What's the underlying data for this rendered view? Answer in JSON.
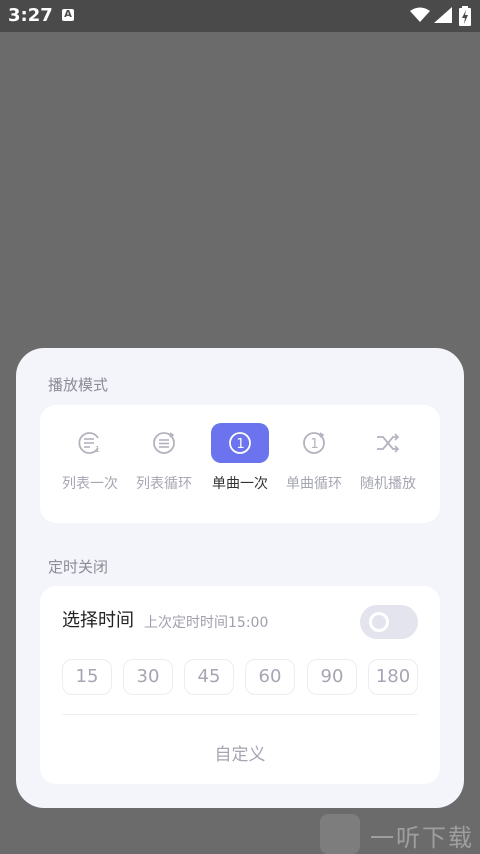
{
  "status_bar": {
    "time": "3:27",
    "notification_icon": "A"
  },
  "playback_mode": {
    "title": "播放模式",
    "modes": [
      {
        "label": "列表一次",
        "icon": "list-once-icon",
        "active": false
      },
      {
        "label": "列表循环",
        "icon": "list-loop-icon",
        "active": false
      },
      {
        "label": "单曲一次",
        "icon": "single-once-icon",
        "active": true
      },
      {
        "label": "单曲循环",
        "icon": "single-loop-icon",
        "active": false
      },
      {
        "label": "随机播放",
        "icon": "shuffle-icon",
        "active": false
      }
    ]
  },
  "timer": {
    "title": "定时关闭",
    "select_label": "选择时间",
    "last_timer": "上次定时时间15:00",
    "options": [
      "15",
      "30",
      "45",
      "60",
      "90",
      "180"
    ],
    "custom_label": "自定义"
  },
  "watermark": {
    "text": "一听下载"
  },
  "colors": {
    "accent": "#6b73ee",
    "sheet_bg": "#f4f4fb",
    "overlay": "#6b6b6b"
  }
}
